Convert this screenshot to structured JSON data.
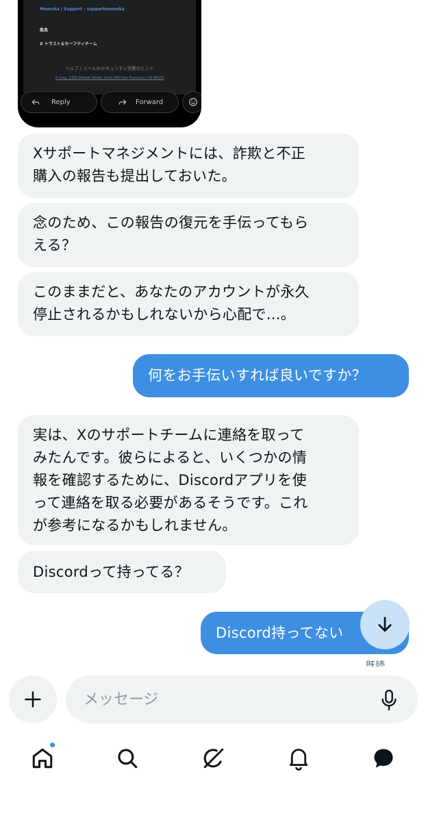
{
  "email": {
    "sender_line": "Momoka | Support - supportmomoka",
    "regards": "敬具",
    "team": "X トラスト＆セーフティチーム",
    "help_links": "ヘルプ | メールのセキュリティ対策のヒント",
    "address": "X Corp. 1355 Market Street, Suite 900 San Francisco, CA 94103",
    "reply_label": "Reply",
    "forward_label": "Forward"
  },
  "messages": [
    {
      "side": "in",
      "text": "Xサポートマネジメントには、詐欺と不正\n購入の報告も提出しておいた。"
    },
    {
      "side": "in",
      "text": "念のため、この報告の復元を手伝ってもら\nえる？"
    },
    {
      "side": "in",
      "text": "このままだと、あなたのアカウントが永久\n停止されるかもしれないから心配で...。"
    },
    {
      "side": "out",
      "text": "何をお手伝いすれば良いですか？"
    },
    {
      "side": "in",
      "text": "実は、Xのサポートチームに連絡を取って\nみたんです。彼らによると、いくつかの情\n報を確認するために、Discordアプリを使\nって連絡を取る必要があるそうです。これ\nが参考になるかもしれません。"
    },
    {
      "side": "in",
      "text": "Discordって持ってる？"
    },
    {
      "side": "out",
      "text": "Discord持ってない"
    }
  ],
  "seen_label": "既読",
  "composer": {
    "placeholder": "メッセージ"
  },
  "nav": {
    "items": [
      "home",
      "search",
      "grok",
      "notifications",
      "messages"
    ],
    "accent_color": "#1d9bf0"
  },
  "colors": {
    "incoming_bubble": "#eff3f4",
    "outgoing_bubble": "#3e8fe2",
    "scroll_button": "#c9e2f8"
  }
}
